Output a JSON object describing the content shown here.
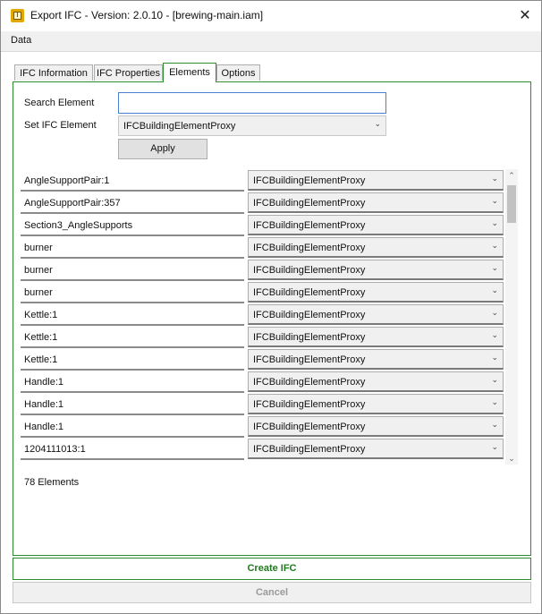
{
  "window": {
    "title": "Export IFC - Version: 2.0.10 - [brewing-main.iam]",
    "close_symbol": "✕",
    "app_icon": "autodesk-inventor-icon"
  },
  "menu": {
    "items": [
      "Data"
    ]
  },
  "tabs": [
    {
      "label": "IFC Information",
      "active": false
    },
    {
      "label": "IFC Properties",
      "active": false
    },
    {
      "label": "Elements",
      "active": true
    },
    {
      "label": "Options",
      "active": false
    }
  ],
  "search": {
    "label": "Search Element",
    "value": "",
    "placeholder": ""
  },
  "set_ifc": {
    "label": "Set IFC Element",
    "value": "IFCBuildingElementProxy"
  },
  "apply_label": "Apply",
  "elements": [
    {
      "name": "AngleSupportPair:1",
      "type": "IFCBuildingElementProxy"
    },
    {
      "name": "AngleSupportPair:357",
      "type": "IFCBuildingElementProxy"
    },
    {
      "name": "Section3_AngleSupports",
      "type": "IFCBuildingElementProxy"
    },
    {
      "name": "burner",
      "type": "IFCBuildingElementProxy"
    },
    {
      "name": "burner",
      "type": "IFCBuildingElementProxy"
    },
    {
      "name": "burner",
      "type": "IFCBuildingElementProxy"
    },
    {
      "name": "Kettle:1",
      "type": "IFCBuildingElementProxy"
    },
    {
      "name": "Kettle:1",
      "type": "IFCBuildingElementProxy"
    },
    {
      "name": "Kettle:1",
      "type": "IFCBuildingElementProxy"
    },
    {
      "name": "Handle:1",
      "type": "IFCBuildingElementProxy"
    },
    {
      "name": "Handle:1",
      "type": "IFCBuildingElementProxy"
    },
    {
      "name": "Handle:1",
      "type": "IFCBuildingElementProxy"
    },
    {
      "name": "1204111013:1",
      "type": "IFCBuildingElementProxy"
    }
  ],
  "element_count": "78  Elements",
  "create_label": "Create IFC",
  "cancel_label": "Cancel",
  "colors": {
    "accent": "#2e8b2e",
    "create_text": "#1f7a1f",
    "disabled_text": "#9a9a9a"
  }
}
